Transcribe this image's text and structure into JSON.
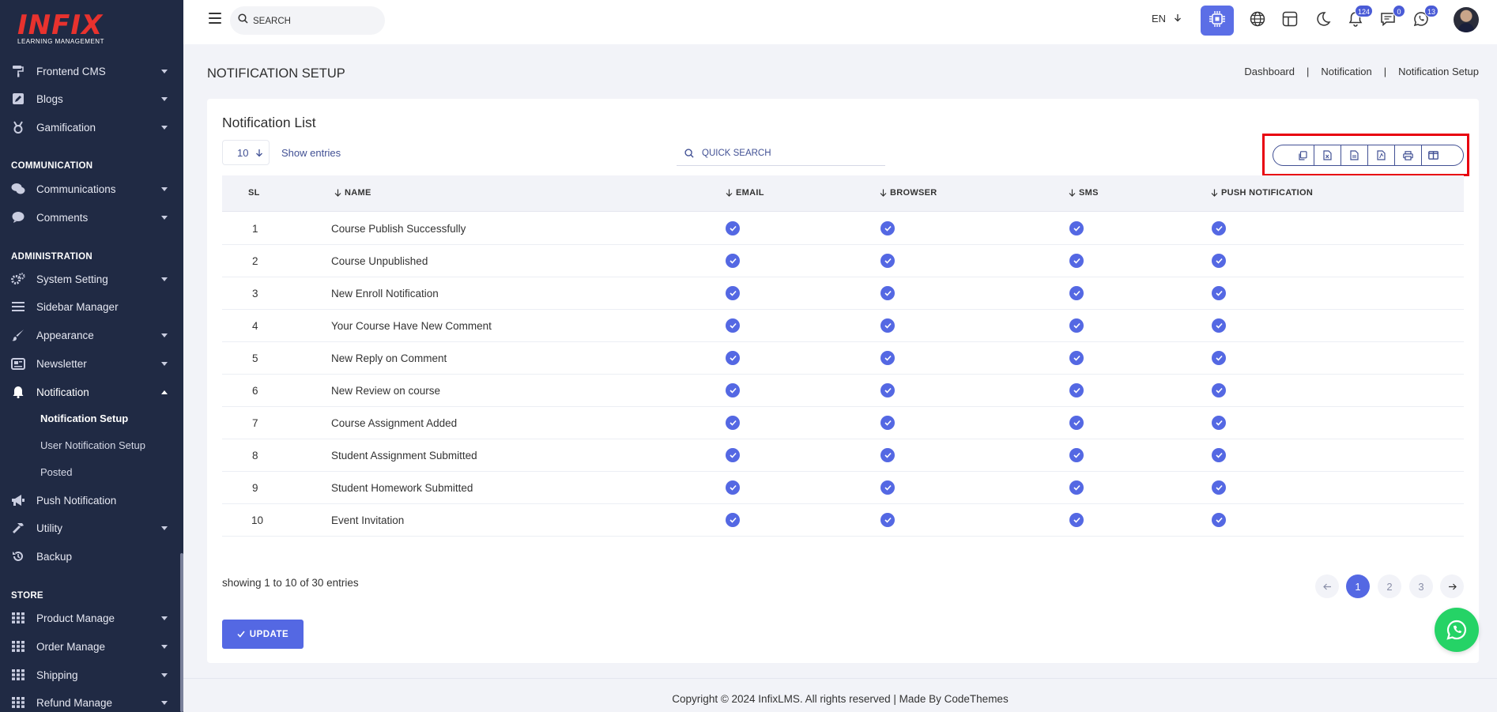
{
  "logo": {
    "brand": "INFIX",
    "tagline": "LEARNING MANAGEMENT"
  },
  "sidebar": {
    "items": [
      {
        "label": "Frontend CMS",
        "icon": "paint-roller-icon"
      },
      {
        "label": "Blogs",
        "icon": "pen-square-icon"
      },
      {
        "label": "Gamification",
        "icon": "medal-icon"
      }
    ],
    "sections": {
      "communication": "COMMUNICATION",
      "administration": "ADMINISTRATION",
      "store": "STORE"
    },
    "communication_items": [
      {
        "label": "Communications",
        "icon": "chat-bubbles-icon"
      },
      {
        "label": "Comments",
        "icon": "comment-icon"
      }
    ],
    "admin_items": [
      {
        "label": "System Setting",
        "icon": "gears-icon"
      },
      {
        "label": "Sidebar Manager",
        "icon": "list-icon"
      },
      {
        "label": "Appearance",
        "icon": "brush-icon"
      },
      {
        "label": "Newsletter",
        "icon": "newsletter-icon"
      },
      {
        "label": "Notification",
        "icon": "bell-icon"
      }
    ],
    "notification_sub": [
      "Notification Setup",
      "User Notification Setup",
      "Posted"
    ],
    "admin_items_2": [
      {
        "label": "Push Notification",
        "icon": "megaphone-icon"
      },
      {
        "label": "Utility",
        "icon": "hammer-icon"
      },
      {
        "label": "Backup",
        "icon": "history-icon"
      }
    ],
    "store_items": [
      {
        "label": "Product Manage",
        "icon": "grid-icon"
      },
      {
        "label": "Order Manage",
        "icon": "grid-icon"
      },
      {
        "label": "Shipping",
        "icon": "grid-icon"
      },
      {
        "label": "Refund Manage",
        "icon": "grid-icon"
      }
    ]
  },
  "topbar": {
    "search_placeholder": "SEARCH",
    "language": "EN",
    "badges": {
      "notifications": "124",
      "messages": "0",
      "chat": "13"
    }
  },
  "page": {
    "title": "NOTIFICATION SETUP",
    "breadcrumb": [
      "Dashboard",
      "Notification",
      "Notification Setup"
    ]
  },
  "card": {
    "title": "Notification List",
    "page_length": "10",
    "show_entries": "Show entries",
    "quick_search_placeholder": "QUICK SEARCH"
  },
  "table": {
    "columns": [
      "SL",
      "NAME",
      "EMAIL",
      "BROWSER",
      "SMS",
      "PUSH NOTIFICATION"
    ],
    "rows": [
      {
        "sl": "1",
        "name": "Course Publish Successfully"
      },
      {
        "sl": "2",
        "name": "Course Unpublished"
      },
      {
        "sl": "3",
        "name": "New Enroll Notification"
      },
      {
        "sl": "4",
        "name": "Your Course Have New Comment"
      },
      {
        "sl": "5",
        "name": "New Reply on Comment"
      },
      {
        "sl": "6",
        "name": "New Review on course"
      },
      {
        "sl": "7",
        "name": "Course Assignment Added"
      },
      {
        "sl": "8",
        "name": "Student Assignment Submitted"
      },
      {
        "sl": "9",
        "name": "Student Homework Submitted"
      },
      {
        "sl": "10",
        "name": "Event Invitation"
      }
    ]
  },
  "pagination": {
    "info": "showing 1 to 10 of 30 entries",
    "pages": [
      "1",
      "2",
      "3"
    ],
    "current": "1"
  },
  "actions": {
    "update": "UPDATE"
  },
  "footer": {
    "text": "Copyright © 2024 InfixLMS. All rights reserved | Made By CodeThemes"
  },
  "colors": {
    "accent": "#5468e3",
    "sidebar": "#202a44",
    "highlight": "#e8000f",
    "whatsapp": "#25d366"
  }
}
